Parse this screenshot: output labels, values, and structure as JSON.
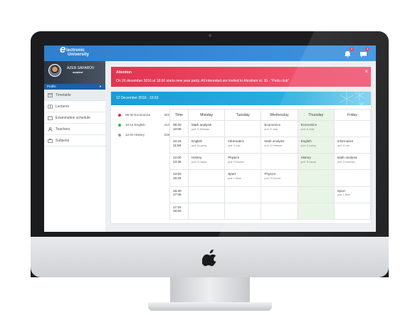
{
  "app": {
    "logo_line1": "lectronic",
    "logo_line2": "University",
    "logo_letter": "e",
    "notifications": {
      "count": "2",
      "messages": "3"
    }
  },
  "profile": {
    "name": "AZER SAFAROV",
    "role": "student",
    "menu_label": "Profile"
  },
  "nav": [
    {
      "label": "Timetable",
      "icon": "timetable-icon",
      "active": true
    },
    {
      "label": "Lectures",
      "icon": "book-icon"
    },
    {
      "label": "Examination schedule",
      "icon": "calendar-icon"
    },
    {
      "label": "Teachers",
      "icon": "user-icon"
    },
    {
      "label": "Subjects",
      "icon": "briefcase-icon"
    }
  ],
  "alert": {
    "title": "Attention",
    "text": "On 26 december 2016 at 18:00 starts new year party. All interested are invited to Abraham st. 35 - \"Pedo club\"",
    "close": "×"
  },
  "timetable": {
    "date_header": "12 December 2016 - 10:33",
    "today_classes": [
      {
        "time_subject": "08:30 Economics",
        "room": "322",
        "color": "#e0263f"
      },
      {
        "time_subject": "10:15 English",
        "room": "412",
        "color": "#38b449"
      },
      {
        "time_subject": "12:00 History",
        "room": "315",
        "color": "#9a9a9a"
      }
    ],
    "columns": [
      "Time",
      "Monday",
      "Tuesday",
      "Wednesday",
      "Thursday",
      "Friday"
    ],
    "rows": [
      {
        "start": "08:30",
        "end": "10:05",
        "cells": [
          {
            "subject": "Math analysis",
            "prof": "prof. D.Hellman"
          },
          null,
          {
            "subject": "Economics",
            "prof": "prof. K.Jelly"
          },
          {
            "subject": "Economics",
            "prof": "prof. K.Jelly"
          },
          null
        ]
      },
      {
        "start": "10:15",
        "end": "11:50",
        "cells": [
          {
            "subject": "English",
            "prof": "prof. A.Lanny"
          },
          {
            "subject": "Informatics",
            "prof": "prof. K.Lee"
          },
          {
            "subject": "Math analysis",
            "prof": "prof. D.Hellman"
          },
          {
            "subject": "English",
            "prof": "prof. A.Lanny"
          },
          {
            "subject": "Informatics",
            "prof": "prof. K.Lee"
          }
        ]
      },
      {
        "start": "12:00",
        "end": "13:35",
        "cells": [
          {
            "subject": "History",
            "prof": "prof. R.Jacob"
          },
          {
            "subject": "Physics",
            "prof": "prof. P.Goover"
          },
          null,
          {
            "subject": "History",
            "prof": "prof. R.Jacob"
          },
          {
            "subject": "Math analysis",
            "prof": "prof. D.Hellman"
          }
        ]
      },
      {
        "start": "13:50",
        "end": "15:25",
        "cells": [
          null,
          {
            "subject": "Sport",
            "prof": "prof. L.Bom"
          },
          {
            "subject": "Physics",
            "prof": "prof. P.Goover"
          },
          null,
          null
        ]
      },
      {
        "start": "15:30",
        "end": "17:05",
        "cells": [
          null,
          null,
          null,
          null,
          {
            "subject": "Sport",
            "prof": "prof. L.Bom"
          }
        ]
      },
      {
        "start": "17:15",
        "end": "18:50",
        "cells": [
          null,
          null,
          null,
          null,
          null
        ]
      }
    ]
  },
  "colors": {
    "topbar": "#2f7fcd",
    "alert": "#e2344f",
    "panel_header": "#1a9bd5",
    "today_column": "#e7f4e4"
  }
}
